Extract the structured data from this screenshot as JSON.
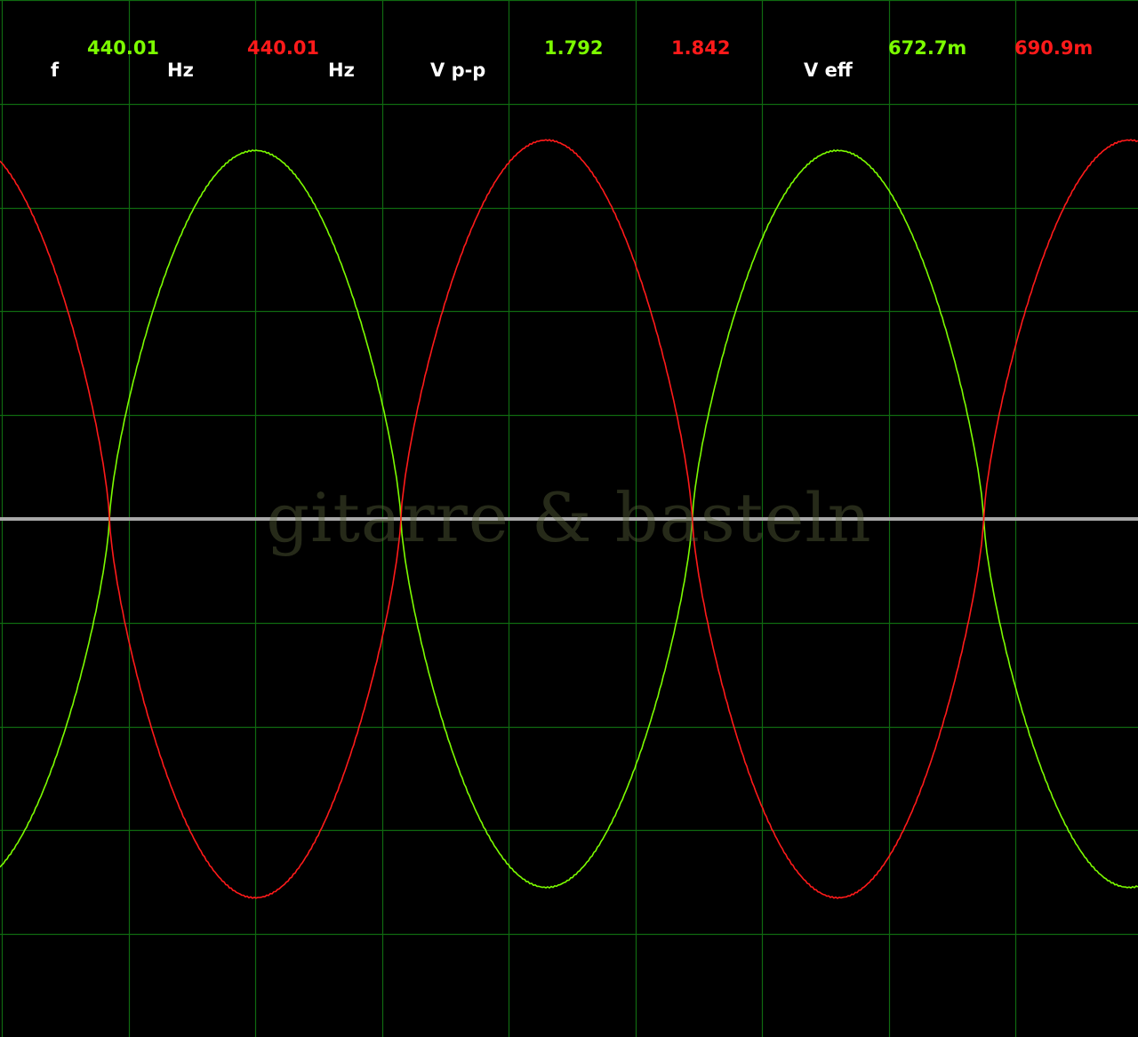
{
  "readouts": {
    "freq_label": "f",
    "freq_ch1": "440.01",
    "freq_unit_1": "Hz",
    "freq_ch2": "440.01",
    "freq_unit_2": "Hz",
    "vpp_label": "V p-p",
    "vpp_ch1": "1.792",
    "vpp_ch2": "1.842",
    "veff_label": "V eff",
    "veff_ch1": "672.7m",
    "veff_ch2": "690.9m"
  },
  "watermark": "gitarre & basteln",
  "colors": {
    "background": "#000000",
    "grid": "#0f6a10",
    "baseline": "#a8a8a8",
    "ch1": "#7cfc00",
    "ch2": "#ff1a1a",
    "label": "#ffffff"
  },
  "chart_data": {
    "type": "line",
    "title": "",
    "xlabel": "",
    "ylabel": "",
    "grid": true,
    "x_divisions": 9,
    "y_divisions": 10,
    "series": [
      {
        "color": "#7cfc00",
        "frequency_hz": 440.01,
        "vpp": 1.792,
        "veff": "672.7m",
        "period_div": 4.6,
        "peak_div": 3.55,
        "phase_peak_div": 2.0,
        "phase_offset_deg": 0
      },
      {
        "color": "#ff1a1a",
        "frequency_hz": 440.01,
        "vpp": 1.842,
        "veff": "690.9m",
        "period_div": 4.6,
        "peak_div": 3.65,
        "phase_peak_div": 4.3,
        "phase_offset_deg": 180
      }
    ]
  }
}
